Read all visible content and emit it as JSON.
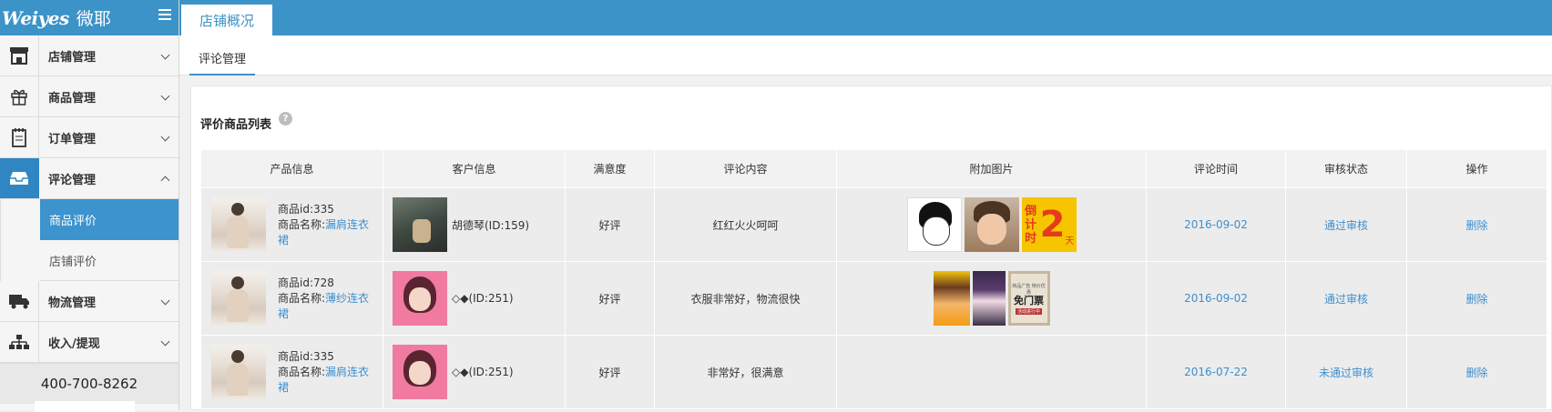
{
  "sidebar": {
    "logo": "Weiyes",
    "logo_cn": "微耶",
    "items": [
      {
        "label": "店铺管理"
      },
      {
        "label": "商品管理"
      },
      {
        "label": "订单管理"
      },
      {
        "label": "评论管理"
      },
      {
        "label": "物流管理"
      },
      {
        "label": "收入/提现"
      }
    ],
    "sub_items": [
      {
        "label": "商品评价"
      },
      {
        "label": "店铺评价"
      }
    ],
    "phone": "400-700-8262"
  },
  "topbar": {
    "tab": "店铺概况"
  },
  "subtabs": {
    "tab": "评论管理"
  },
  "panel": {
    "title": "评价商品列表",
    "help": "?"
  },
  "table": {
    "headers": [
      "产品信息",
      "客户信息",
      "满意度",
      "评论内容",
      "附加图片",
      "评论时间",
      "审核状态",
      "操作"
    ],
    "rows": [
      {
        "product_id": "商品id:335",
        "product_name_prefix": "商品名称:",
        "product_name": "漏肩连衣裙",
        "customer": "胡德琴(ID:159)",
        "satisfaction": "好评",
        "comment": "红红火火呵呵",
        "time": "2016-09-02",
        "status": "通过审核",
        "action": "删除",
        "pic3_left": "倒计时",
        "pic3_num": "2",
        "pic3_unit": "天"
      },
      {
        "product_id": "商品id:728",
        "product_name_prefix": "商品名称:",
        "product_name": "薄纱连衣裙",
        "customer": "◇◆(ID:251)",
        "satisfaction": "好评",
        "comment": "衣服非常好，物流很快",
        "time": "2016-09-02",
        "status": "通过审核",
        "action": "删除",
        "sign_top": "商品广告 特价优惠",
        "sign_mid": "免门票",
        "sign_bot": "活动进行中"
      },
      {
        "product_id": "商品id:335",
        "product_name_prefix": "商品名称:",
        "product_name": "漏肩连衣裙",
        "customer": "◇◆(ID:251)",
        "satisfaction": "好评",
        "comment": "非常好，很满意",
        "time": "2016-07-22",
        "status": "未通过审核",
        "action": "删除"
      }
    ]
  },
  "colors": {
    "brand": "#3c93c7",
    "active_nav": "#3d93cd",
    "link": "#3d8fcf"
  }
}
